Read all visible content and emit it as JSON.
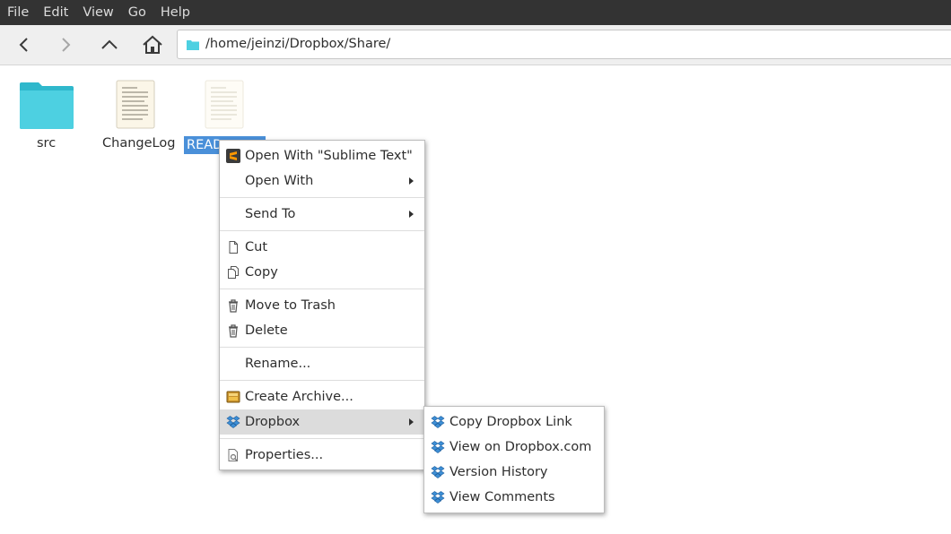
{
  "menubar": {
    "items": [
      "File",
      "Edit",
      "View",
      "Go",
      "Help"
    ]
  },
  "toolbar": {
    "back_icon": "chevron-left-icon",
    "forward_icon": "chevron-right-icon",
    "up_icon": "chevron-up-icon",
    "home_icon": "home-icon",
    "path": "/home/jeinzi/Dropbox/Share/"
  },
  "files": [
    {
      "name": "src",
      "type": "folder"
    },
    {
      "name": "ChangeLog",
      "type": "text"
    },
    {
      "name": "README",
      "type": "text",
      "selected": true,
      "visible_label": "READ"
    }
  ],
  "context_menu": {
    "open_with_sublime": "Open With \"Sublime Text\"",
    "open_with": "Open With",
    "send_to": "Send To",
    "cut": "Cut",
    "copy": "Copy",
    "move_to_trash": "Move to Trash",
    "delete": "Delete",
    "rename": "Rename...",
    "create_archive": "Create Archive...",
    "dropbox": "Dropbox",
    "properties": "Properties..."
  },
  "dropbox_submenu": {
    "copy_link": "Copy Dropbox Link",
    "view_on_web": "View on Dropbox.com",
    "version_history": "Version History",
    "view_comments": "View Comments"
  },
  "colors": {
    "menubar_bg": "#333333",
    "selection": "#4a90d9",
    "folder": "#4dd0e1",
    "dropbox_blue": "#3d8fd6",
    "sublime_orange": "#ff9800",
    "highlight_row": "#dcdcdc"
  }
}
